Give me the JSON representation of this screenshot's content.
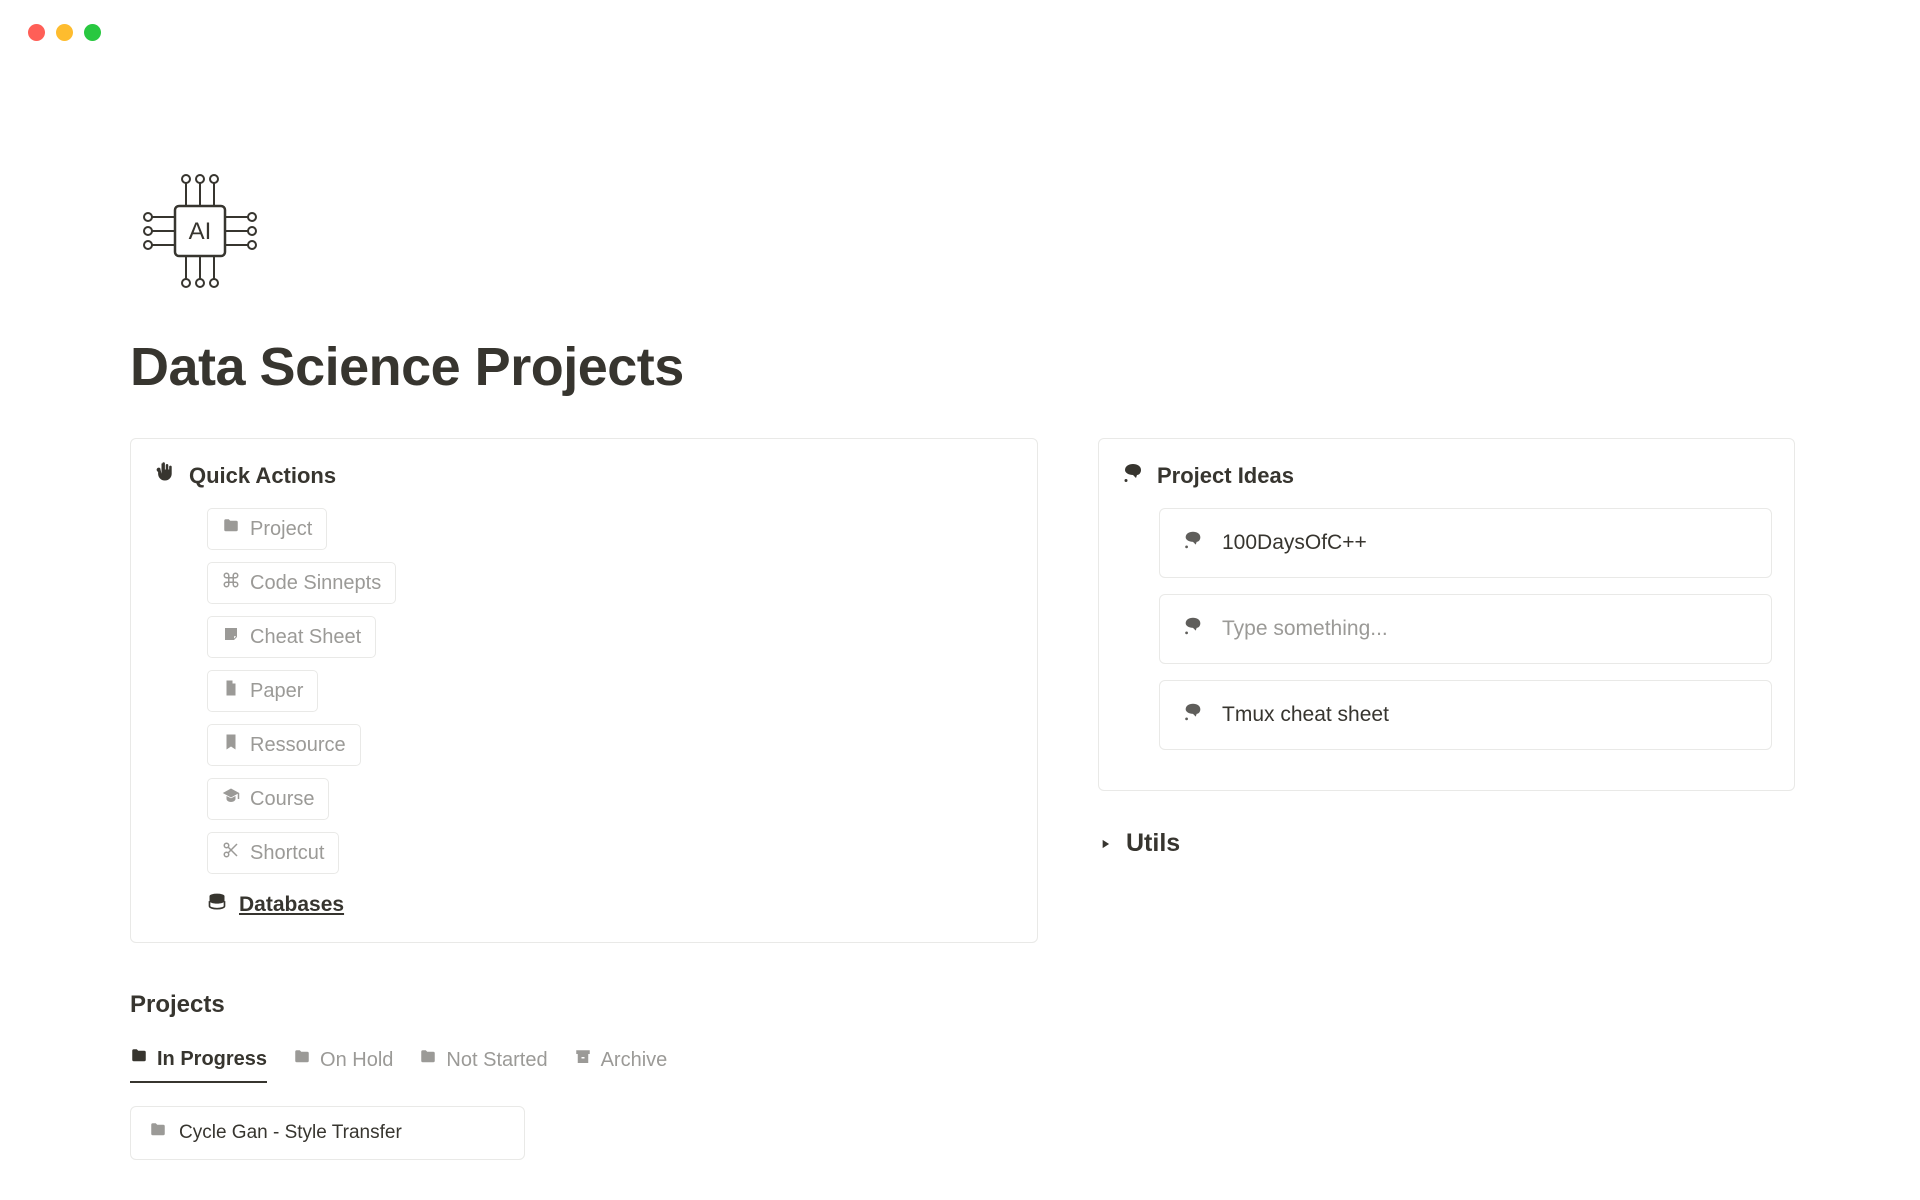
{
  "page": {
    "title": "Data Science Projects"
  },
  "quickActions": {
    "title": "Quick Actions",
    "items": [
      {
        "label": "Project",
        "icon": "folder"
      },
      {
        "label": "Code Sinnepts",
        "icon": "command"
      },
      {
        "label": "Cheat Sheet",
        "icon": "note"
      },
      {
        "label": "Paper",
        "icon": "page"
      },
      {
        "label": "Ressource",
        "icon": "bookmark"
      },
      {
        "label": "Course",
        "icon": "graduation"
      },
      {
        "label": "Shortcut",
        "icon": "scissors"
      }
    ],
    "databasesLabel": "Databases"
  },
  "projectIdeas": {
    "title": "Project Ideas",
    "items": [
      {
        "label": "100DaysOfC++"
      },
      {
        "label": "Type something...",
        "placeholder": true
      },
      {
        "label": "Tmux cheat sheet"
      }
    ]
  },
  "utils": {
    "label": "Utils"
  },
  "projects": {
    "title": "Projects",
    "tabs": [
      {
        "label": "In Progress",
        "active": true
      },
      {
        "label": "On Hold"
      },
      {
        "label": "Not Started"
      },
      {
        "label": "Archive"
      }
    ],
    "cards": [
      {
        "label": "Cycle Gan - Style Transfer"
      }
    ]
  }
}
